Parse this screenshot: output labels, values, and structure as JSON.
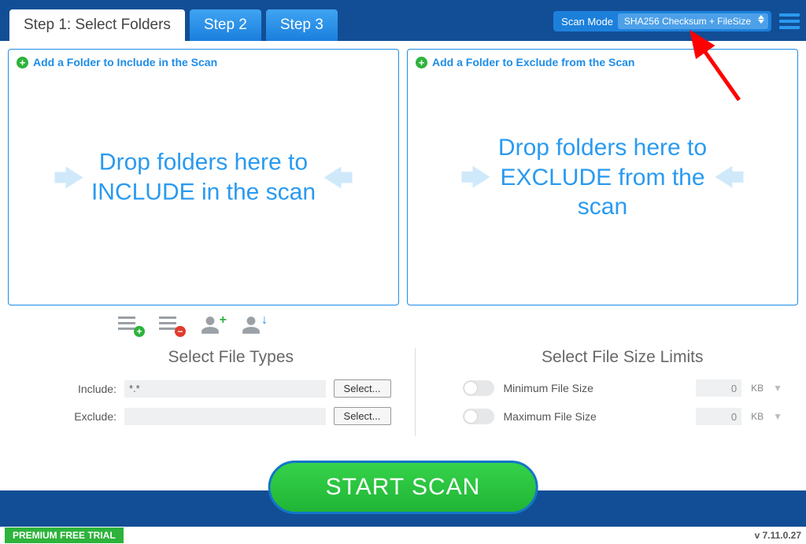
{
  "tabs": {
    "t1": "Step 1: Select Folders",
    "t2": "Step 2",
    "t3": "Step 3"
  },
  "scanmode": {
    "label": "Scan Mode",
    "value": "SHA256 Checksum + FileSize"
  },
  "include_panel": {
    "add_label": "Add a Folder to Include in the Scan",
    "drop_l1": "Drop folders here to",
    "drop_l2": "INCLUDE in the scan"
  },
  "exclude_panel": {
    "add_label": "Add a Folder to Exclude from the Scan",
    "drop_l1": "Drop folders here to",
    "drop_l2": "EXCLUDE from the",
    "drop_l3": "scan"
  },
  "filetypes": {
    "title": "Select File Types",
    "include_label": "Include:",
    "include_value": "*.*",
    "exclude_label": "Exclude:",
    "exclude_value": "",
    "select_btn": "Select..."
  },
  "filesize": {
    "title": "Select File Size Limits",
    "min_label": "Minimum File Size",
    "max_label": "Maximum File Size",
    "min_value": "0",
    "max_value": "0",
    "unit": "KB"
  },
  "start_label": "START SCAN",
  "trial_label": "PREMIUM FREE TRIAL",
  "version": "v 7.11.0.27"
}
